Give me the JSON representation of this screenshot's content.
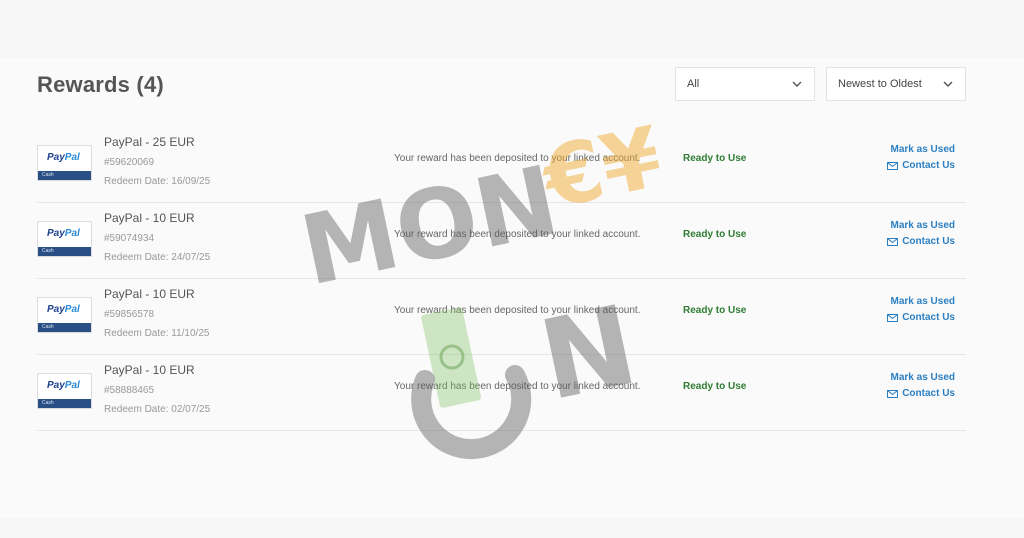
{
  "page": {
    "title": "Rewards (4)"
  },
  "filters": {
    "type": {
      "selected": "All"
    },
    "sort": {
      "selected": "Newest to Oldest"
    }
  },
  "rewards": [
    {
      "name": "PayPal - 25 EUR",
      "code": "#59620069",
      "redeem": "Redeem Date: 16/09/25",
      "message": "Your reward has been deposited to your linked account.",
      "status": "Ready to Use",
      "mark": "Mark as Used",
      "contact": "Contact Us"
    },
    {
      "name": "PayPal - 10 EUR",
      "code": "#59074934",
      "redeem": "Redeem Date: 24/07/25",
      "message": "Your reward has been deposited to your linked account.",
      "status": "Ready to Use",
      "mark": "Mark as Used",
      "contact": "Contact Us"
    },
    {
      "name": "PayPal - 10 EUR",
      "code": "#59856578",
      "redeem": "Redeem Date: 11/10/25",
      "message": "Your reward has been deposited to your linked account.",
      "status": "Ready to Use",
      "mark": "Mark as Used",
      "contact": "Contact Us"
    },
    {
      "name": "PayPal - 10 EUR",
      "code": "#58888465",
      "redeem": "Redeem Date: 02/07/25",
      "message": "Your reward has been deposited to your linked account.",
      "status": "Ready to Use",
      "mark": "Mark as Used",
      "contact": "Contact Us"
    }
  ],
  "logo": {
    "pay": "Pay",
    "pal": "Pal",
    "sub": "Cash"
  },
  "watermark": {
    "line1": "MON",
    "symbols": "€¥",
    "line2": "N"
  },
  "colors": {
    "accent": "#2b7fc3",
    "status": "#2e7d32",
    "paypal_dark": "#1b3f8c",
    "paypal_light": "#2b8ad8"
  }
}
